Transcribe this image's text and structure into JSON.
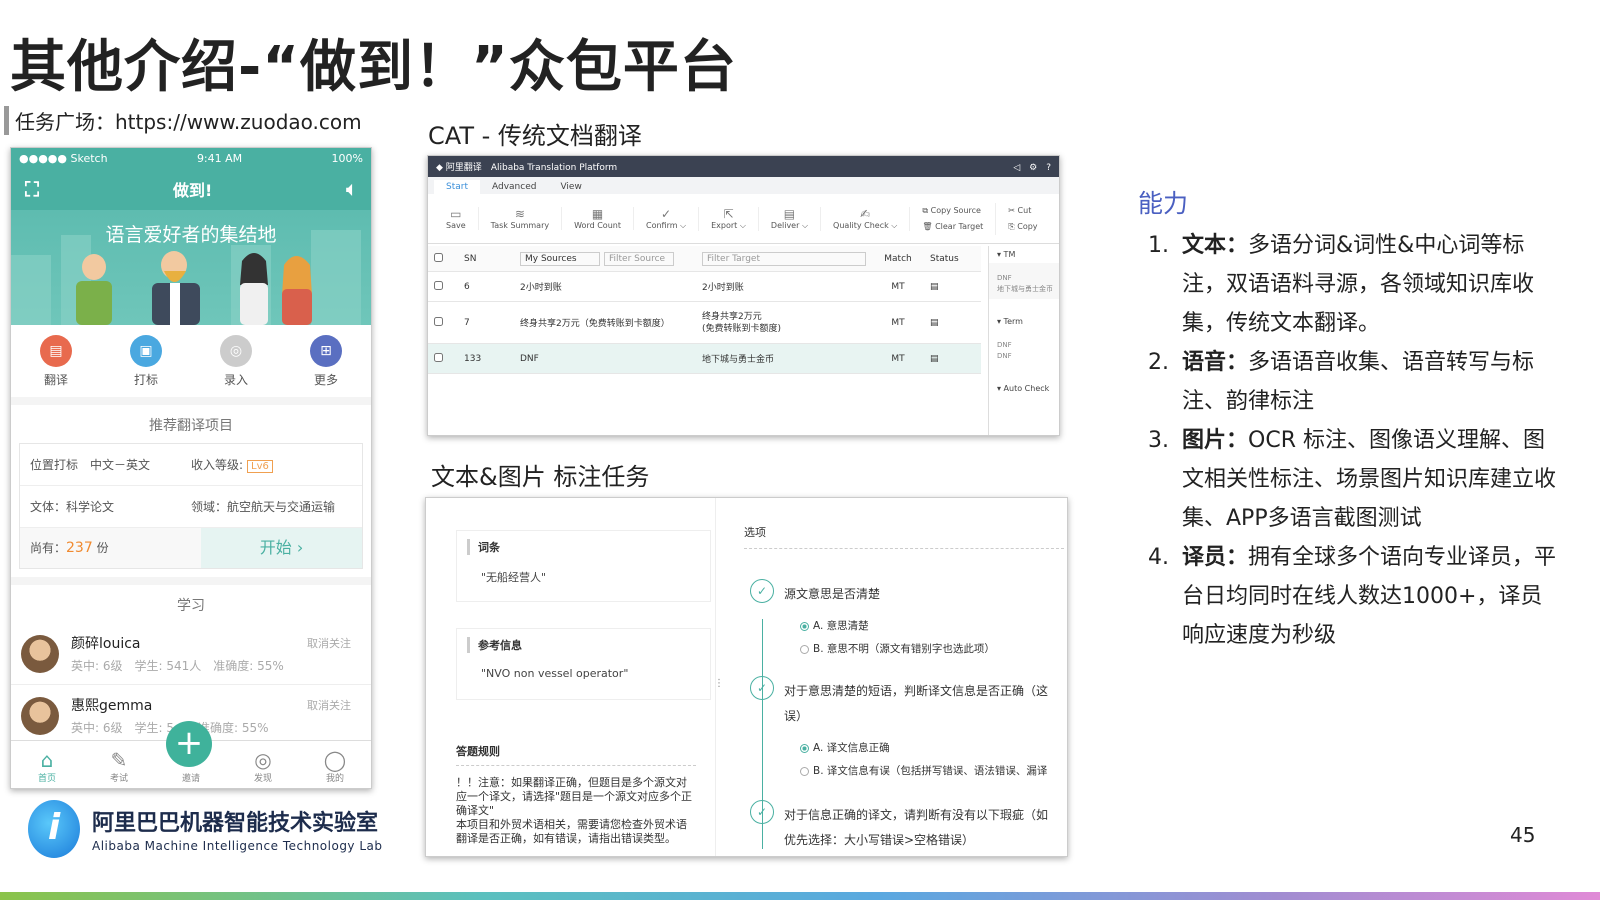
{
  "title": "其他介绍-“做到！”众包平台",
  "subtitle": "任务广场：https://www.zuodao.com",
  "labels": {
    "cat": "CAT - 传统文档翻译",
    "annotation": "文本&图片 标注任务"
  },
  "page_number": "45",
  "colors": {
    "teal": "#4ab0a2",
    "accent_blue": "#4a5fc1"
  },
  "phone": {
    "status": {
      "carrier": "●●●●● Sketch",
      "time": "9:41 AM",
      "battery": "100%"
    },
    "nav_title": "做到!",
    "banner_text": "语言爱好者的集结地",
    "icons": [
      {
        "label": "翻译",
        "icon": "document-icon"
      },
      {
        "label": "打标",
        "icon": "briefcase-icon"
      },
      {
        "label": "录入",
        "icon": "camera-icon"
      },
      {
        "label": "更多",
        "icon": "grid-icon"
      }
    ],
    "recommend": {
      "heading": "推荐翻译项目",
      "r1a": "位置打标　中文－英文",
      "r1b_label": "收入等级:",
      "r1b_level": "Lv6",
      "r2a": "文体：科学论文",
      "r2b": "领域：航空航天与交通运输",
      "remaining_label": "尚有：",
      "remaining_count": "237",
      "remaining_unit": "份",
      "start": "开始 ›"
    },
    "learn": {
      "heading": "学习",
      "users": [
        {
          "name": "颜碎louica",
          "meta": "英中: 6级　学生: 541人　准确度: 55%",
          "action": "取消关注"
        },
        {
          "name": "惠熙gemma",
          "meta": "英中: 6级　学生: 5…　准确度: 55%",
          "action": "取消关注"
        }
      ]
    },
    "tabs": [
      "首页",
      "考试",
      "邀请",
      "发现",
      "我的"
    ]
  },
  "logo": {
    "cn": "阿里巴巴机器智能技术实验室",
    "en": "Alibaba Machine Intelligence Technology Lab"
  },
  "cat": {
    "app_name": "阿里翻译",
    "platform": "Alibaba Translation Platform",
    "tabs": [
      "Start",
      "Advanced",
      "View"
    ],
    "tools": [
      "Save",
      "Task Summary",
      "Word Count",
      "Confirm ⌵",
      "Export ⌵",
      "Deliver ⌵",
      "Quality Check ⌵"
    ],
    "copy_source": "Copy Source",
    "clear_target": "Clear Target",
    "cut": "Cut",
    "copy": "Copy",
    "headers": {
      "sn": "SN",
      "source": "My Sources",
      "filter_source": "Filter Source",
      "target": "Filter Target",
      "match": "Match",
      "status": "Status"
    },
    "rows": [
      {
        "sn": "6",
        "source": "2小时到账",
        "target": "2小时到账",
        "match": "MT"
      },
      {
        "sn": "7",
        "source": "终身共享2万元（免费转账到卡额度）",
        "target": "终身共享2万元\n(免费转账到卡额度)",
        "match": "MT"
      },
      {
        "sn": "133",
        "source": "DNF",
        "target": "地下城与勇士金币",
        "match": "MT"
      }
    ],
    "side": {
      "tm": "▾ TM",
      "tm1": "DNF",
      "tm2": "地下城与勇士金币",
      "term": "▾ Term",
      "term1": "DNF",
      "term2": "DNF",
      "auto": "▾ Auto Check"
    }
  },
  "annotation": {
    "entry_h": "词条",
    "entry": "\"无船经营人\"",
    "ref_h": "参考信息",
    "ref": "\"NVO non vessel operator\"",
    "rule_h": "答题规则",
    "rule": "！！注意：如果翻译正确，但题目是多个源文对应一个译文，请选择\"题目是一个源文对应多个正确译文\"\n本项目和外贸术语相关，需要请您检查外贸术语翻译是否正确，如有错误，请指出错误类型。",
    "options_h": "选项",
    "q1": "源文意思是否清楚",
    "q1a": "A. 意思清楚",
    "q1b": "B. 意思不明（源文有错别字也选此项）",
    "q2": "对于意思清楚的短语，判断译文信息是否正确（这",
    "q2cont": "误）",
    "q2a": "A. 译文信息正确",
    "q2b": "B. 译文信息有误（包括拼写错误、语法错误、漏译",
    "q3": "对于信息正确的译文，请判断有没有以下瑕疵（如",
    "q3cont": "优先选择：大小写错误>空格错误）"
  },
  "capabilities": {
    "heading": "能力",
    "items": [
      {
        "num": "1.",
        "key": "文本：",
        "text": "多语分词&词性&中心词等标注，双语语料寻源，各领域知识库收集，传统文本翻译。"
      },
      {
        "num": "2.",
        "key": "语音：",
        "text": "多语语音收集、语音转写与标注、韵律标注"
      },
      {
        "num": "3.",
        "key": "图片：",
        "text": "OCR 标注、图像语义理解、图文相关性标注、场景图片知识库建立收集、APP多语言截图测试"
      },
      {
        "num": "4.",
        "key": "译员：",
        "text": "拥有全球多个语向专业译员，平台日均同时在线人数达1000+，译员响应速度为秒级"
      }
    ]
  }
}
